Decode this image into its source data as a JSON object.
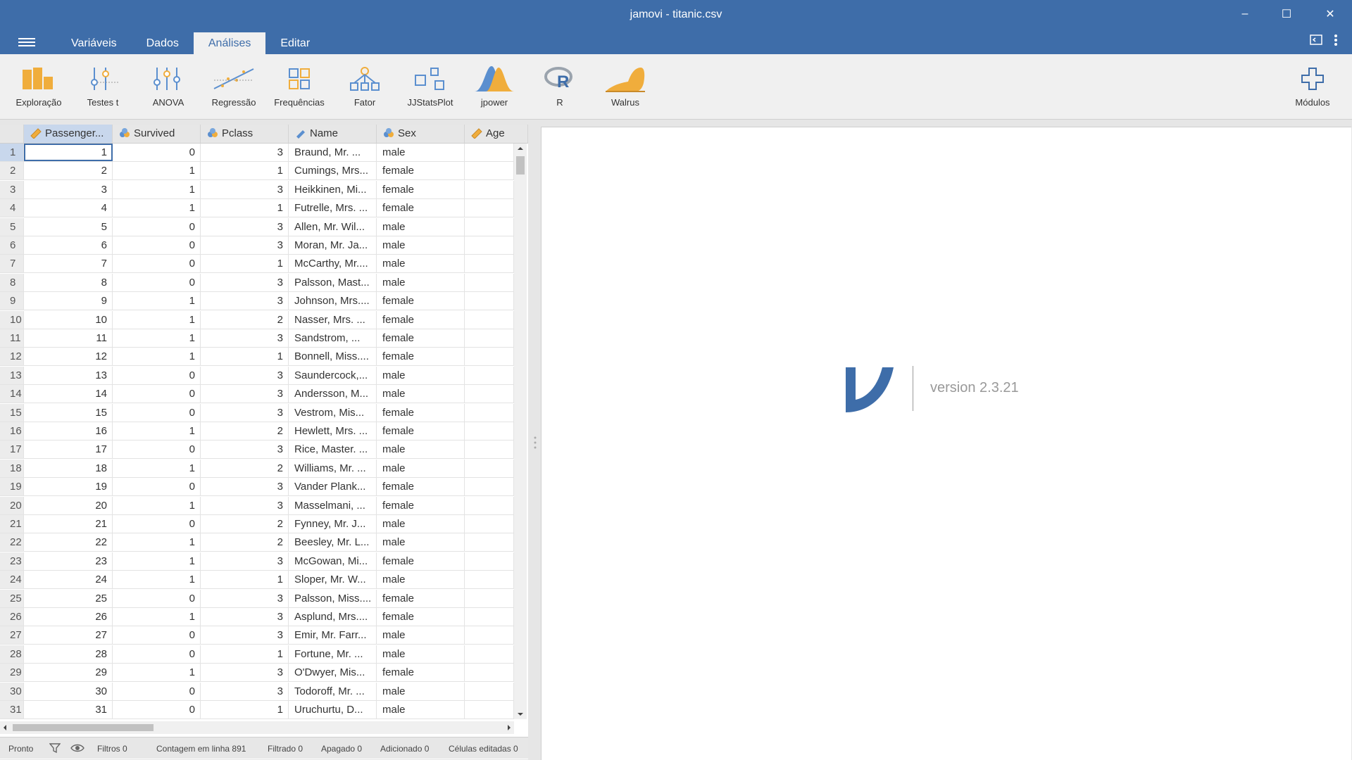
{
  "window": {
    "title": "jamovi - titanic.csv",
    "minimize": "–",
    "maximize": "☐",
    "close": "✕"
  },
  "tabs": [
    {
      "label": "Variáveis",
      "active": false
    },
    {
      "label": "Dados",
      "active": false
    },
    {
      "label": "Análises",
      "active": true
    },
    {
      "label": "Editar",
      "active": false
    }
  ],
  "ribbon": [
    {
      "label": "Exploração",
      "icon": "exploration-icon"
    },
    {
      "label": "Testes t",
      "icon": "t-tests-icon"
    },
    {
      "label": "ANOVA",
      "icon": "anova-icon"
    },
    {
      "label": "Regressão",
      "icon": "regression-icon"
    },
    {
      "label": "Frequências",
      "icon": "frequencies-icon"
    },
    {
      "label": "Fator",
      "icon": "factor-icon"
    },
    {
      "label": "JJStatsPlot",
      "icon": "jjstatsplot-icon"
    },
    {
      "label": "jpower",
      "icon": "jpower-icon"
    },
    {
      "label": "R",
      "icon": "r-icon"
    },
    {
      "label": "Walrus",
      "icon": "walrus-icon"
    },
    {
      "label": "Módulos",
      "icon": "plus-icon"
    }
  ],
  "columns": [
    {
      "name": "Passenger...",
      "type": "continuous"
    },
    {
      "name": "Survived",
      "type": "nominal"
    },
    {
      "name": "Pclass",
      "type": "nominal"
    },
    {
      "name": "Name",
      "type": "text"
    },
    {
      "name": "Sex",
      "type": "nominal-text"
    },
    {
      "name": "Age",
      "type": "continuous"
    }
  ],
  "rows": [
    [
      "1",
      "1",
      "0",
      "3",
      "Braund, Mr. ...",
      "male",
      ""
    ],
    [
      "2",
      "2",
      "1",
      "1",
      "Cumings, Mrs...",
      "female",
      ""
    ],
    [
      "3",
      "3",
      "1",
      "3",
      "Heikkinen, Mi...",
      "female",
      ""
    ],
    [
      "4",
      "4",
      "1",
      "1",
      "Futrelle, Mrs. ...",
      "female",
      ""
    ],
    [
      "5",
      "5",
      "0",
      "3",
      "Allen, Mr. Wil...",
      "male",
      ""
    ],
    [
      "6",
      "6",
      "0",
      "3",
      "Moran, Mr. Ja...",
      "male",
      ""
    ],
    [
      "7",
      "7",
      "0",
      "1",
      "McCarthy, Mr....",
      "male",
      ""
    ],
    [
      "8",
      "8",
      "0",
      "3",
      "Palsson, Mast...",
      "male",
      ""
    ],
    [
      "9",
      "9",
      "1",
      "3",
      "Johnson, Mrs....",
      "female",
      ""
    ],
    [
      "10",
      "10",
      "1",
      "2",
      "Nasser, Mrs. ...",
      "female",
      ""
    ],
    [
      "11",
      "11",
      "1",
      "3",
      "Sandstrom, ...",
      "female",
      ""
    ],
    [
      "12",
      "12",
      "1",
      "1",
      "Bonnell, Miss....",
      "female",
      ""
    ],
    [
      "13",
      "13",
      "0",
      "3",
      "Saundercock,...",
      "male",
      ""
    ],
    [
      "14",
      "14",
      "0",
      "3",
      "Andersson, M...",
      "male",
      ""
    ],
    [
      "15",
      "15",
      "0",
      "3",
      "Vestrom, Mis...",
      "female",
      ""
    ],
    [
      "16",
      "16",
      "1",
      "2",
      "Hewlett, Mrs. ...",
      "female",
      ""
    ],
    [
      "17",
      "17",
      "0",
      "3",
      "Rice, Master. ...",
      "male",
      ""
    ],
    [
      "18",
      "18",
      "1",
      "2",
      "Williams, Mr. ...",
      "male",
      ""
    ],
    [
      "19",
      "19",
      "0",
      "3",
      "Vander Plank...",
      "female",
      ""
    ],
    [
      "20",
      "20",
      "1",
      "3",
      "Masselmani, ...",
      "female",
      ""
    ],
    [
      "21",
      "21",
      "0",
      "2",
      "Fynney, Mr. J...",
      "male",
      ""
    ],
    [
      "22",
      "22",
      "1",
      "2",
      "Beesley, Mr. L...",
      "male",
      ""
    ],
    [
      "23",
      "23",
      "1",
      "3",
      "McGowan, Mi...",
      "female",
      ""
    ],
    [
      "24",
      "24",
      "1",
      "1",
      "Sloper, Mr. W...",
      "male",
      ""
    ],
    [
      "25",
      "25",
      "0",
      "3",
      "Palsson, Miss....",
      "female",
      ""
    ],
    [
      "26",
      "26",
      "1",
      "3",
      "Asplund, Mrs....",
      "female",
      ""
    ],
    [
      "27",
      "27",
      "0",
      "3",
      "Emir, Mr. Farr...",
      "male",
      ""
    ],
    [
      "28",
      "28",
      "0",
      "1",
      "Fortune, Mr. ...",
      "male",
      ""
    ],
    [
      "29",
      "29",
      "1",
      "3",
      "O'Dwyer, Mis...",
      "female",
      ""
    ],
    [
      "30",
      "30",
      "0",
      "3",
      "Todoroff, Mr. ...",
      "male",
      ""
    ],
    [
      "31",
      "31",
      "0",
      "1",
      "Uruchurtu, D...",
      "male",
      ""
    ]
  ],
  "status": {
    "ready": "Pronto",
    "filters": "Filtros 0",
    "row_count": "Contagem em linha 891",
    "filtered": "Filtrado 0",
    "deleted": "Apagado 0",
    "added": "Adicionado 0",
    "edited": "Células editadas 0"
  },
  "results": {
    "version": "version 2.3.21"
  },
  "colors": {
    "brand": "#3e6da9",
    "accent_orange": "#f0ad3c",
    "selection": "#c8d7ec"
  }
}
